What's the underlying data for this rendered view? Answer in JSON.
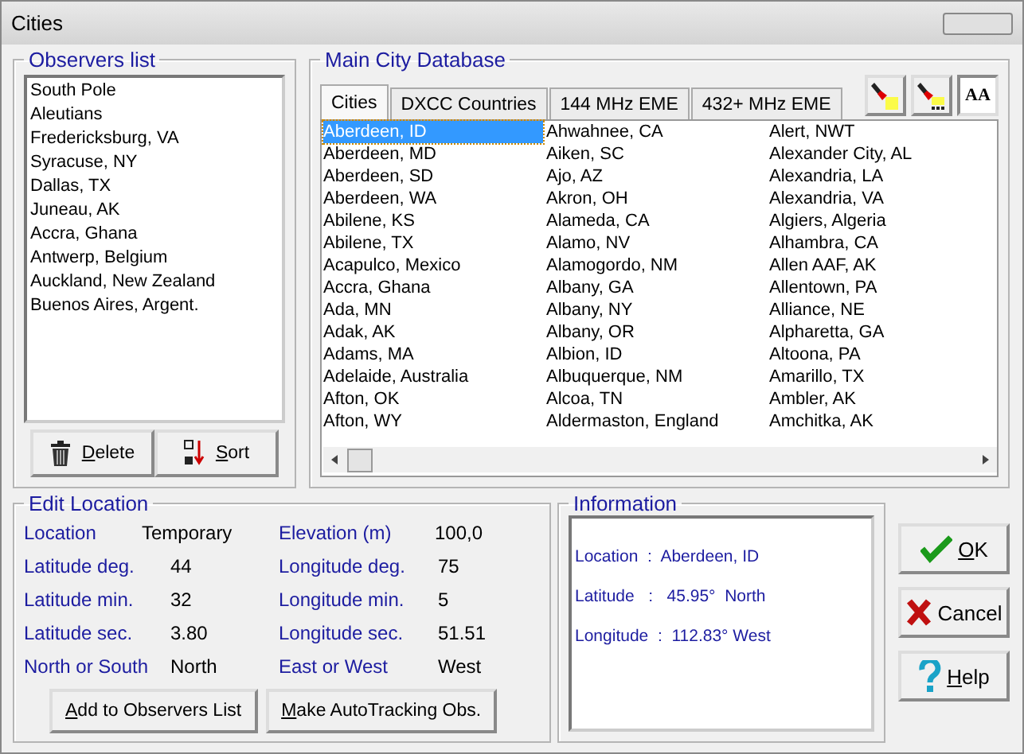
{
  "window": {
    "title": "Cities"
  },
  "observers": {
    "title": "Observers list",
    "items": [
      "South Pole",
      "Aleutians",
      "Fredericksburg, VA",
      "Syracuse, NY",
      "Dallas, TX",
      "Juneau, AK",
      "Accra, Ghana",
      "Antwerp, Belgium",
      "Auckland, New Zealand",
      "Buenos Aires, Argent."
    ],
    "buttons": [
      {
        "label": "Delete",
        "kind": "delete",
        "mnemonic": true
      },
      {
        "label": "Sort",
        "kind": "sort",
        "mnemonic": true
      }
    ]
  },
  "database": {
    "title": "Main City Database",
    "tabs": [
      {
        "label": "Cities",
        "selected": true
      },
      {
        "label": "DXCC Countries",
        "selected": false
      },
      {
        "label": "144 MHz EME",
        "selected": false
      },
      {
        "label": "432+ MHz EME",
        "selected": false
      }
    ],
    "tools": [
      {
        "kind": "flashlight",
        "pressed": false
      },
      {
        "kind": "flashlight-dots",
        "pressed": false
      },
      {
        "kind": "font",
        "label": "AA",
        "pressed": true
      }
    ],
    "columns": [
      {
        "rows": [
          {
            "name": "Aberdeen, ID",
            "selected": true
          },
          {
            "name": "Aberdeen, MD",
            "selected": false
          },
          {
            "name": "Aberdeen, SD",
            "selected": false
          },
          {
            "name": "Aberdeen, WA",
            "selected": false
          },
          {
            "name": "Abilene, KS",
            "selected": false
          },
          {
            "name": "Abilene, TX",
            "selected": false
          },
          {
            "name": "Acapulco, Mexico",
            "selected": false
          },
          {
            "name": "Accra, Ghana",
            "selected": false
          },
          {
            "name": "Ada, MN",
            "selected": false
          },
          {
            "name": "Adak, AK",
            "selected": false
          },
          {
            "name": "Adams, MA",
            "selected": false
          },
          {
            "name": "Adelaide, Australia",
            "selected": false
          },
          {
            "name": "Afton, OK",
            "selected": false
          },
          {
            "name": "Afton, WY",
            "selected": false
          }
        ]
      },
      {
        "rows": [
          {
            "name": "Ahwahnee, CA",
            "selected": false
          },
          {
            "name": "Aiken, SC",
            "selected": false
          },
          {
            "name": "Ajo, AZ",
            "selected": false
          },
          {
            "name": "Akron, OH",
            "selected": false
          },
          {
            "name": "Alameda, CA",
            "selected": false
          },
          {
            "name": "Alamo, NV",
            "selected": false
          },
          {
            "name": "Alamogordo, NM",
            "selected": false
          },
          {
            "name": "Albany, GA",
            "selected": false
          },
          {
            "name": "Albany, NY",
            "selected": false
          },
          {
            "name": "Albany, OR",
            "selected": false
          },
          {
            "name": "Albion, ID",
            "selected": false
          },
          {
            "name": "Albuquerque, NM",
            "selected": false
          },
          {
            "name": "Alcoa, TN",
            "selected": false
          },
          {
            "name": "Aldermaston, England",
            "selected": false
          }
        ]
      },
      {
        "rows": [
          {
            "name": "Alert, NWT",
            "selected": false
          },
          {
            "name": "Alexander City, AL",
            "selected": false
          },
          {
            "name": "Alexandria, LA",
            "selected": false
          },
          {
            "name": "Alexandria, VA",
            "selected": false
          },
          {
            "name": "Algiers, Algeria",
            "selected": false
          },
          {
            "name": "Alhambra, CA",
            "selected": false
          },
          {
            "name": "Allen AAF, AK",
            "selected": false
          },
          {
            "name": "Allentown, PA",
            "selected": false
          },
          {
            "name": "Alliance, NE",
            "selected": false
          },
          {
            "name": "Alpharetta, GA",
            "selected": false
          },
          {
            "name": "Altoona, PA",
            "selected": false
          },
          {
            "name": "Amarillo, TX",
            "selected": false
          },
          {
            "name": "Ambler, AK",
            "selected": false
          },
          {
            "name": "Amchitka, AK",
            "selected": false
          }
        ]
      }
    ]
  },
  "edit_location": {
    "title": "Edit Location",
    "fields": [
      {
        "label": "Location",
        "value": "Temporary"
      },
      {
        "label": "Elevation (m)",
        "value": "100,0"
      },
      {
        "label": "Latitude deg.",
        "value": "44"
      },
      {
        "label": "Longitude deg.",
        "value": "75"
      },
      {
        "label": "Latitude min.",
        "value": "32"
      },
      {
        "label": "Longitude min.",
        "value": "5"
      },
      {
        "label": "Latitude sec.",
        "value": "3.80"
      },
      {
        "label": "Longitude sec.",
        "value": "51.51"
      },
      {
        "label": "North or South",
        "value": "North"
      },
      {
        "label": "East or West",
        "value": "West"
      }
    ],
    "buttons": [
      {
        "label": "Add to Observers List",
        "mnemonic": true
      },
      {
        "label": "Make AutoTracking Obs.",
        "mnemonic": true
      }
    ]
  },
  "information": {
    "title": "Information",
    "lines": [
      "Location  :  Aberdeen, ID",
      "Latitude   :   45.95°  North",
      "Longitude  :  112.83° West"
    ]
  },
  "dialog_buttons": [
    {
      "label": "OK",
      "kind": "ok",
      "mnemonic": true
    },
    {
      "label": "Cancel",
      "kind": "cancel",
      "mnemonic": false
    },
    {
      "label": "Help",
      "kind": "help",
      "mnemonic": true
    }
  ]
}
